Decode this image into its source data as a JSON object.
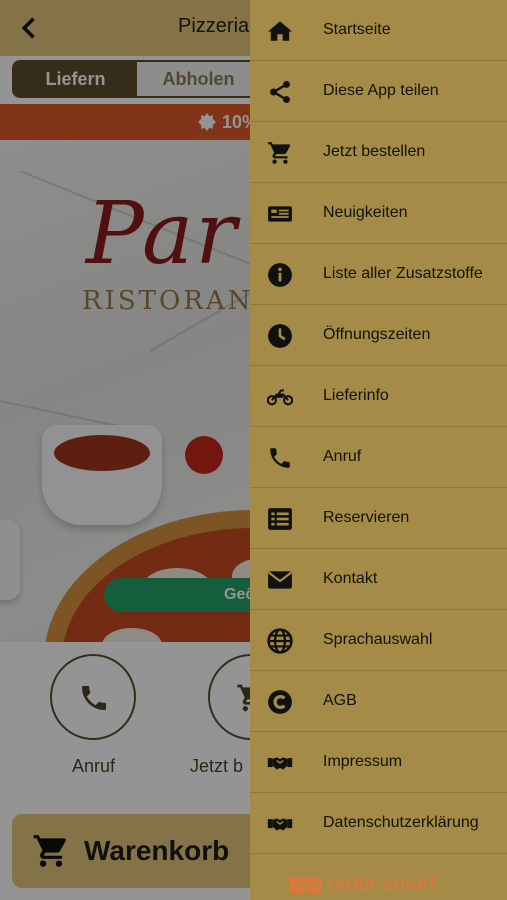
{
  "app": {
    "title": "Pizzeria",
    "back_icon": "chevron-left-icon",
    "order_mode": {
      "delivery_label": "Liefern",
      "pickup_label": "Abholen",
      "selected": "Liefern"
    },
    "promo": {
      "text": "10%",
      "icon": "badge-icon",
      "color": "#e05a2a"
    },
    "hero": {
      "logo_script": "Par",
      "logo_sub": "RISTORANTE",
      "status_button": "Geö"
    },
    "actions": [
      {
        "label": "Anruf",
        "icon": "phone-icon"
      },
      {
        "label": "Jetzt b",
        "icon": "cart-icon"
      }
    ],
    "cart_button": {
      "label": "Warenkorb",
      "icon": "cart-icon"
    }
  },
  "drawer": {
    "background": "#a48c48",
    "items": [
      {
        "label": "Startseite",
        "icon": "home-icon"
      },
      {
        "label": "Diese App teilen",
        "icon": "share-icon"
      },
      {
        "label": "Jetzt bestellen",
        "icon": "cart-icon"
      },
      {
        "label": "Neuigkeiten",
        "icon": "newspaper-icon"
      },
      {
        "label": "Liste aller Zusatzstoffe",
        "icon": "info-icon"
      },
      {
        "label": "Öffnungszeiten",
        "icon": "clock-icon"
      },
      {
        "label": "Lieferinfo",
        "icon": "motorcycle-icon"
      },
      {
        "label": "Anruf",
        "icon": "phone-icon"
      },
      {
        "label": "Reservieren",
        "icon": "list-icon"
      },
      {
        "label": "Kontakt",
        "icon": "envelope-icon"
      },
      {
        "label": "Sprachauswahl",
        "icon": "globe-icon"
      },
      {
        "label": "AGB",
        "icon": "copyright-icon"
      },
      {
        "label": "Impressum",
        "icon": "handshake-icon"
      },
      {
        "label": "Datenschutzerklärung",
        "icon": "handshake-icon"
      }
    ],
    "brand": {
      "text": "order smart",
      "color": "#e4753a"
    }
  }
}
